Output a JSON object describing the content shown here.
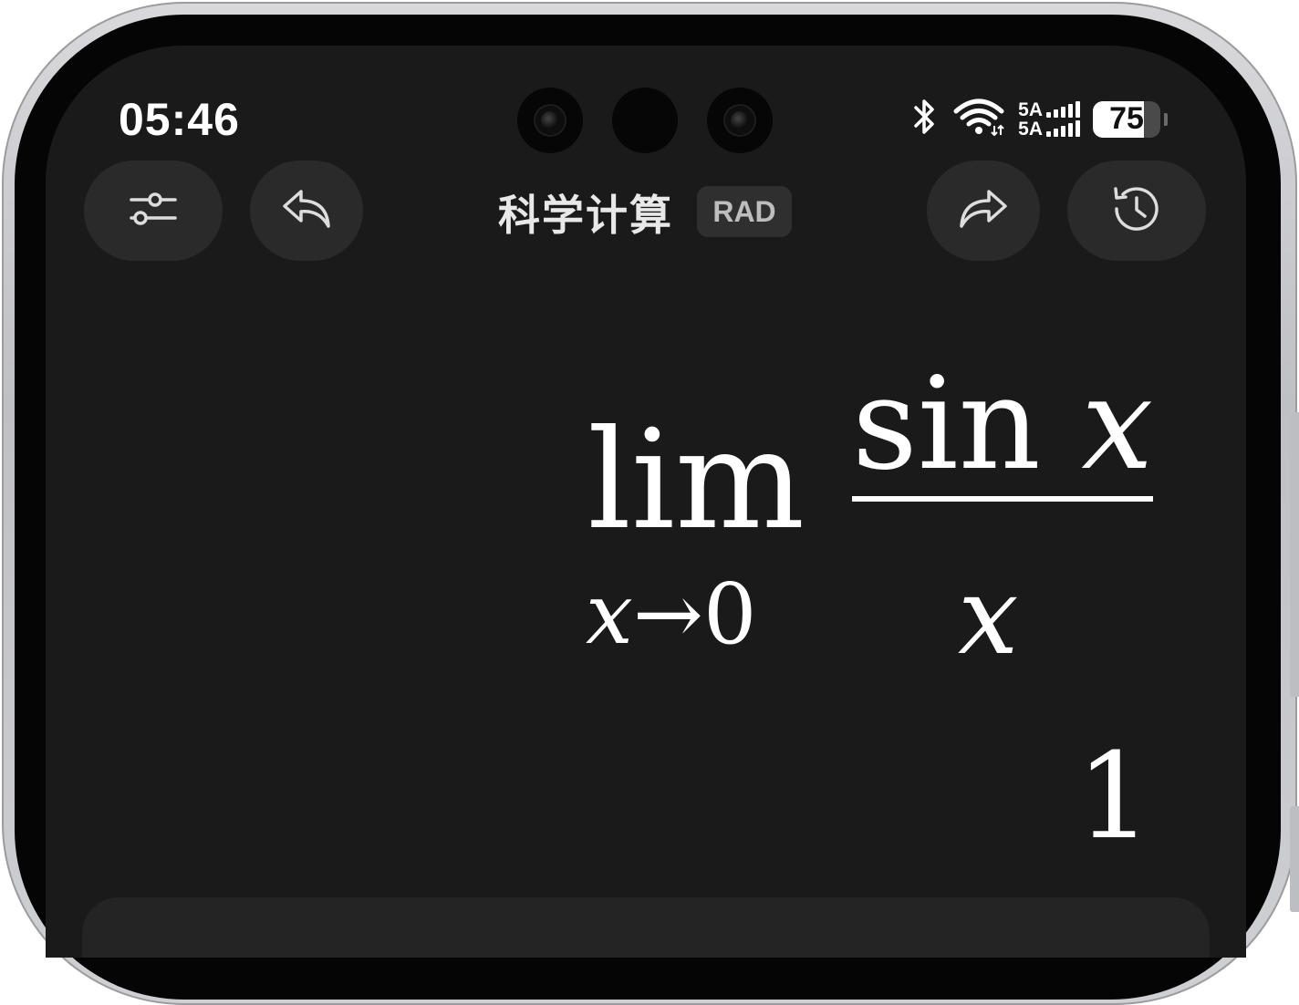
{
  "status_bar": {
    "time": "05:46",
    "network_top": "5A",
    "network_bottom": "5A",
    "battery_percent": 75,
    "battery_label": "75",
    "icons": [
      "bluetooth-icon",
      "wifi-icon",
      "cellular-signal-icon",
      "battery-icon"
    ]
  },
  "toolbar": {
    "title": "科学计算",
    "angle_mode": "RAD",
    "left_buttons": [
      "settings-sliders-icon",
      "undo-icon"
    ],
    "right_buttons": [
      "redo-icon",
      "history-icon"
    ]
  },
  "expression": {
    "operator": "lim",
    "limit_variable": "x",
    "limit_arrow": "→",
    "limit_target": "0",
    "numerator_func": "sin",
    "numerator_var": "x",
    "denominator": "x"
  },
  "result": {
    "value": "1"
  },
  "colors": {
    "background": "#1a1a1a",
    "button_bg": "#2a2a2a",
    "text": "#ffffff",
    "badge_bg": "#2f2f2f"
  }
}
